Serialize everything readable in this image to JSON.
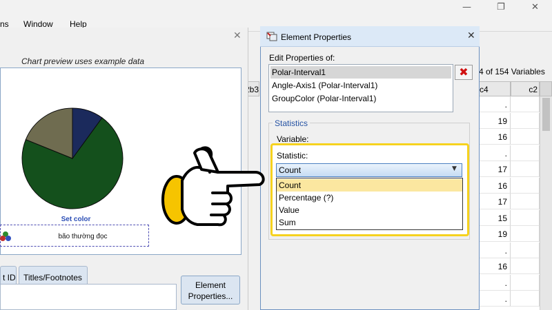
{
  "menu": {
    "items": [
      "ns",
      "Window",
      "Help"
    ]
  },
  "builder": {
    "preview_caption": "Chart preview uses example data",
    "set_color": "Set color",
    "legend_text": "bão thường đọc",
    "tabs": [
      "t ID",
      "Titles/Footnotes"
    ],
    "element_properties_button": [
      "Element",
      "Properties..."
    ]
  },
  "data_editor": {
    "variables_count": "4 of 154 Variables",
    "left_header": "2b3",
    "columns": [
      "c4",
      "c2"
    ],
    "rows": [
      ".",
      "19",
      "16",
      ".",
      "17",
      "16",
      "17",
      "15",
      "19",
      ".",
      "16",
      ".",
      "."
    ]
  },
  "element_properties": {
    "title": "Element Properties",
    "edit_label": "Edit Properties of:",
    "items": [
      "Polar-Interval1",
      "Angle-Axis1 (Polar-Interval1)",
      "GroupColor (Polar-Interval1)"
    ],
    "selected_index": 0,
    "statistics_group": "Statistics",
    "variable_label": "Variable:",
    "statistic_label": "Statistic:",
    "statistic_value": "Count",
    "options": [
      "Count",
      "Percentage (?)",
      "Value",
      "Sum"
    ],
    "highlighted_option": 0
  },
  "colors": {
    "pie_green": "#14501c",
    "pie_navy": "#1b2a5c",
    "pie_olive": "#6f6c50",
    "highlight_yellow": "#f6d21e",
    "option_highlight": "#fbe7a0"
  }
}
